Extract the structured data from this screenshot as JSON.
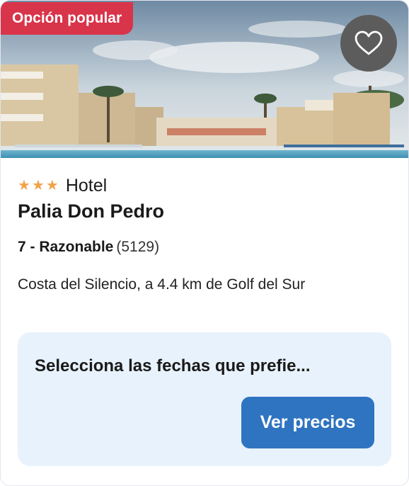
{
  "badge": "Opción popular",
  "favorite_icon": "heart-outline-icon",
  "hotel": {
    "stars": 3,
    "star_glyph": "★",
    "type": "Hotel",
    "name": "Palia Don Pedro",
    "rating_score": "7 - Razonable",
    "rating_count": "(5129)",
    "location": "Costa del Silencio, a 4.4 km de Golf del Sur"
  },
  "cta": {
    "prompt": "Selecciona las fechas que prefie...",
    "button_label": "Ver precios"
  },
  "colors": {
    "badge_bg": "#d8344a",
    "star": "#f0a44a",
    "cta_bg": "#e8f2fc",
    "button_bg": "#2f74c0"
  }
}
